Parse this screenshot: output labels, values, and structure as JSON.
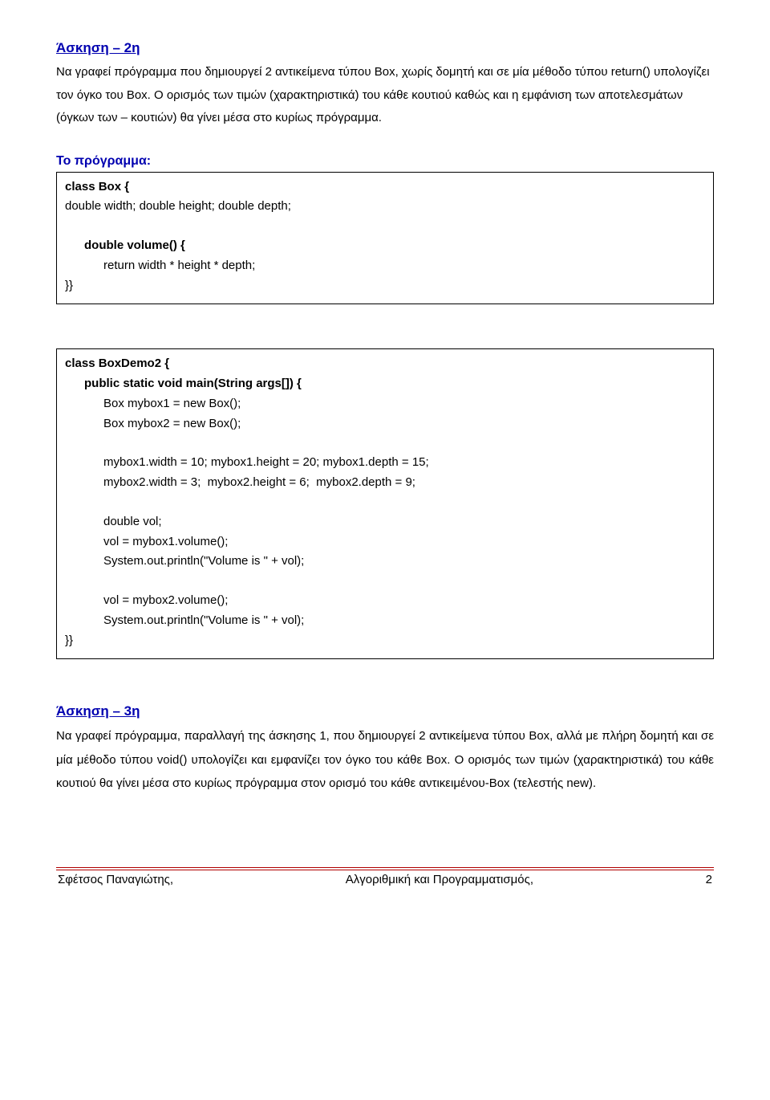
{
  "ex2": {
    "title": "Άσκηση – 2η",
    "para": "Να γραφεί πρόγραμμα που δημιουργεί 2 αντικείμενα τύπου Box, χωρίς δομητή και σε μία μέθοδο τύπου return() υπολογίζει τον όγκο του Box. Ο ορισμός των τιμών (χαρακτηριστικά) του κάθε κουτιού καθώς και η εμφάνιση των αποτελεσμάτων (όγκων των – κουτιών) θα γίνει μέσα στο κυρίως πρόγραμμα.",
    "program_label": "Το πρόγραμμα:"
  },
  "code": {
    "l1": "class Box {",
    "l2": "double width; double height; double depth;",
    "l3": "double volume() {",
    "l4": "return width * height * depth;",
    "l5": "}}",
    "l6": "class BoxDemo2 {",
    "l7": "public static void main(String args[]) {",
    "l8": "Box mybox1 = new Box();",
    "l9": "Box mybox2 = new Box();",
    "l10": "mybox1.width = 10; mybox1.height = 20; mybox1.depth = 15;",
    "l11": "mybox2.width = 3;  mybox2.height = 6;  mybox2.depth = 9;",
    "l12": "double vol;",
    "l13": "vol = mybox1.volume();",
    "l14": "System.out.println(\"Volume is \" + vol);",
    "l15": "vol = mybox2.volume();",
    "l16": "System.out.println(\"Volume is \" + vol);",
    "l17": "}}"
  },
  "ex3": {
    "title": "Άσκηση – 3η",
    "para": "Να γραφεί πρόγραμμα, παραλλαγή της άσκησης 1, που δημιουργεί 2 αντικείμενα τύπου Box, αλλά με πλήρη δομητή και σε μία μέθοδο τύπου void() υπολογίζει και εμφανίζει τον όγκο του κάθε Box. Ο ορισμός των τιμών (χαρακτηριστικά) του κάθε κουτιού θα γίνει μέσα στο κυρίως πρόγραμμα στον ορισμό του κάθε αντικειμένου-Box (τελεστής new)."
  },
  "footer": {
    "left": "Σφέτσος  Παναγιώτης,",
    "center": "Αλγοριθμική και Προγραμματισμός,",
    "right": "2"
  }
}
